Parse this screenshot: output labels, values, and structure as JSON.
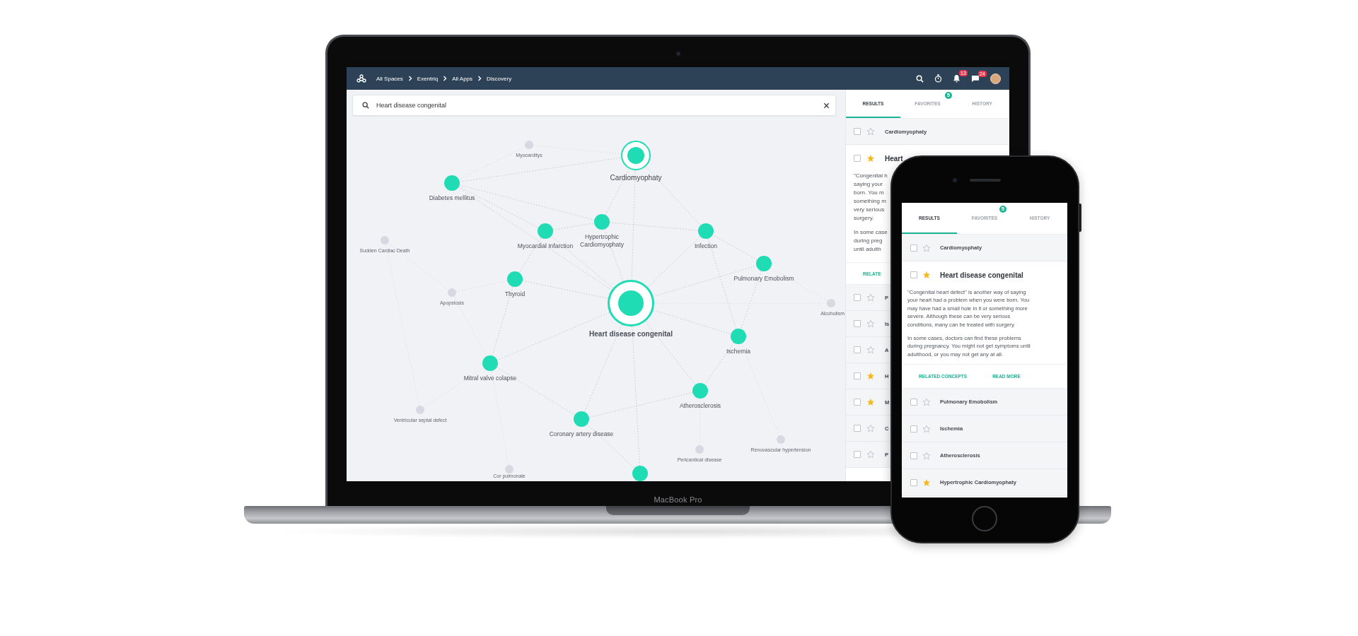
{
  "laptop": {
    "brand": "MacBook Pro",
    "topbar": {
      "breadcrumbs": [
        "All Spaces",
        "Exentriq",
        "All Apps",
        "Discovery"
      ],
      "notifications": {
        "count": "13"
      },
      "messages": {
        "count": "24"
      }
    },
    "search": {
      "value": "Heart disease congenital"
    },
    "graph": {
      "nodes": [
        {
          "label": "Myocarditys",
          "kind": "faint"
        },
        {
          "label": "Cardiomyophaty",
          "kind": "focus"
        },
        {
          "label": "Diabetes mellitus",
          "kind": "match"
        },
        {
          "label": "Myocardial Infarction",
          "kind": "match"
        },
        {
          "label": "Hypertrophic Cardiomyophaty",
          "kind": "match"
        },
        {
          "label": "Infection",
          "kind": "match"
        },
        {
          "label": "Sudden Cardiac Death",
          "kind": "faint"
        },
        {
          "label": "Thyroid",
          "kind": "match"
        },
        {
          "label": "Apopstosis",
          "kind": "faint"
        },
        {
          "label": "Heart disease congenital",
          "kind": "main"
        },
        {
          "label": "Pulmonary Emobolism",
          "kind": "match"
        },
        {
          "label": "Alcoholism",
          "kind": "faint"
        },
        {
          "label": "Ischemia",
          "kind": "match"
        },
        {
          "label": "Mitral valve colapse",
          "kind": "match"
        },
        {
          "label": "Atherosclerosis",
          "kind": "match"
        },
        {
          "label": "Ventricular septal defect",
          "kind": "faint"
        },
        {
          "label": "Coronary artery disease",
          "kind": "match"
        },
        {
          "label": "Pericardical disease",
          "kind": "faint"
        },
        {
          "label": "Renovascular hypertension",
          "kind": "faint"
        },
        {
          "label": "Cor pulmonale",
          "kind": "faint"
        },
        {
          "kind": "match"
        }
      ]
    },
    "panel": {
      "tabs": [
        {
          "label": "RESULTS",
          "selected": true
        },
        {
          "label": "FAVORITES",
          "selected": false,
          "badge": "5"
        },
        {
          "label": "HISTORY",
          "selected": false
        }
      ],
      "results": [
        {
          "kind": "item",
          "title": "Cardiomyophaty",
          "checked": false,
          "starred": false
        },
        {
          "kind": "expanded",
          "title": "Heart",
          "checked": false,
          "starred": true,
          "paragraphs": [
            [
              "\"Congenital h",
              "saying your",
              "born. You m",
              "something m",
              "very serious",
              "surgery."
            ],
            [
              "In some case",
              "during preg",
              "until adulth"
            ]
          ],
          "links": [
            "RELATE"
          ]
        },
        {
          "kind": "item",
          "title": "P",
          "checked": false,
          "starred": false
        },
        {
          "kind": "item",
          "title": "Is",
          "checked": false,
          "starred": false
        },
        {
          "kind": "item",
          "title": "A",
          "checked": false,
          "starred": false
        },
        {
          "kind": "item",
          "title": "H",
          "checked": false,
          "starred": true
        },
        {
          "kind": "item",
          "title": "M",
          "checked": false,
          "starred": true
        },
        {
          "kind": "item",
          "title": "C",
          "checked": false,
          "starred": false
        },
        {
          "kind": "item",
          "title": "P",
          "checked": false,
          "starred": false
        }
      ]
    }
  },
  "phone": {
    "panel": {
      "tabs": [
        {
          "label": "RESULTS",
          "selected": true
        },
        {
          "label": "FAVORITES",
          "selected": false,
          "badge": "5"
        },
        {
          "label": "HISTORY",
          "selected": false
        }
      ],
      "results": [
        {
          "kind": "item",
          "title": "Cardiomyophaty",
          "checked": false,
          "starred": false
        },
        {
          "kind": "expanded",
          "title": "Heart disease congenital",
          "checked": false,
          "starred": true,
          "paragraphs": [
            [
              "\"Congenital heart defect\" is another way of saying",
              "your heart had a problem when you were born. You",
              "may have had a small hole in it or something more",
              "severe. Although these can be very serious",
              "conditions, many can be treated with surgery."
            ],
            [
              "In some cases, doctors can find these problems",
              "during pregnancy. You might not get symptoms until",
              "adulthood, or you may not get any at all."
            ]
          ],
          "links": [
            "RELATED CONCEPTS",
            "READ MORE"
          ]
        },
        {
          "kind": "item",
          "title": "Pulmonary Emobolism",
          "checked": false,
          "starred": false
        },
        {
          "kind": "item",
          "title": "Ischemia",
          "checked": false,
          "starred": false
        },
        {
          "kind": "item",
          "title": "Atherosclerosis",
          "checked": false,
          "starred": false
        },
        {
          "kind": "item",
          "title": "Hypertrophic Cardiomyophaty",
          "checked": false,
          "starred": true
        }
      ]
    }
  }
}
